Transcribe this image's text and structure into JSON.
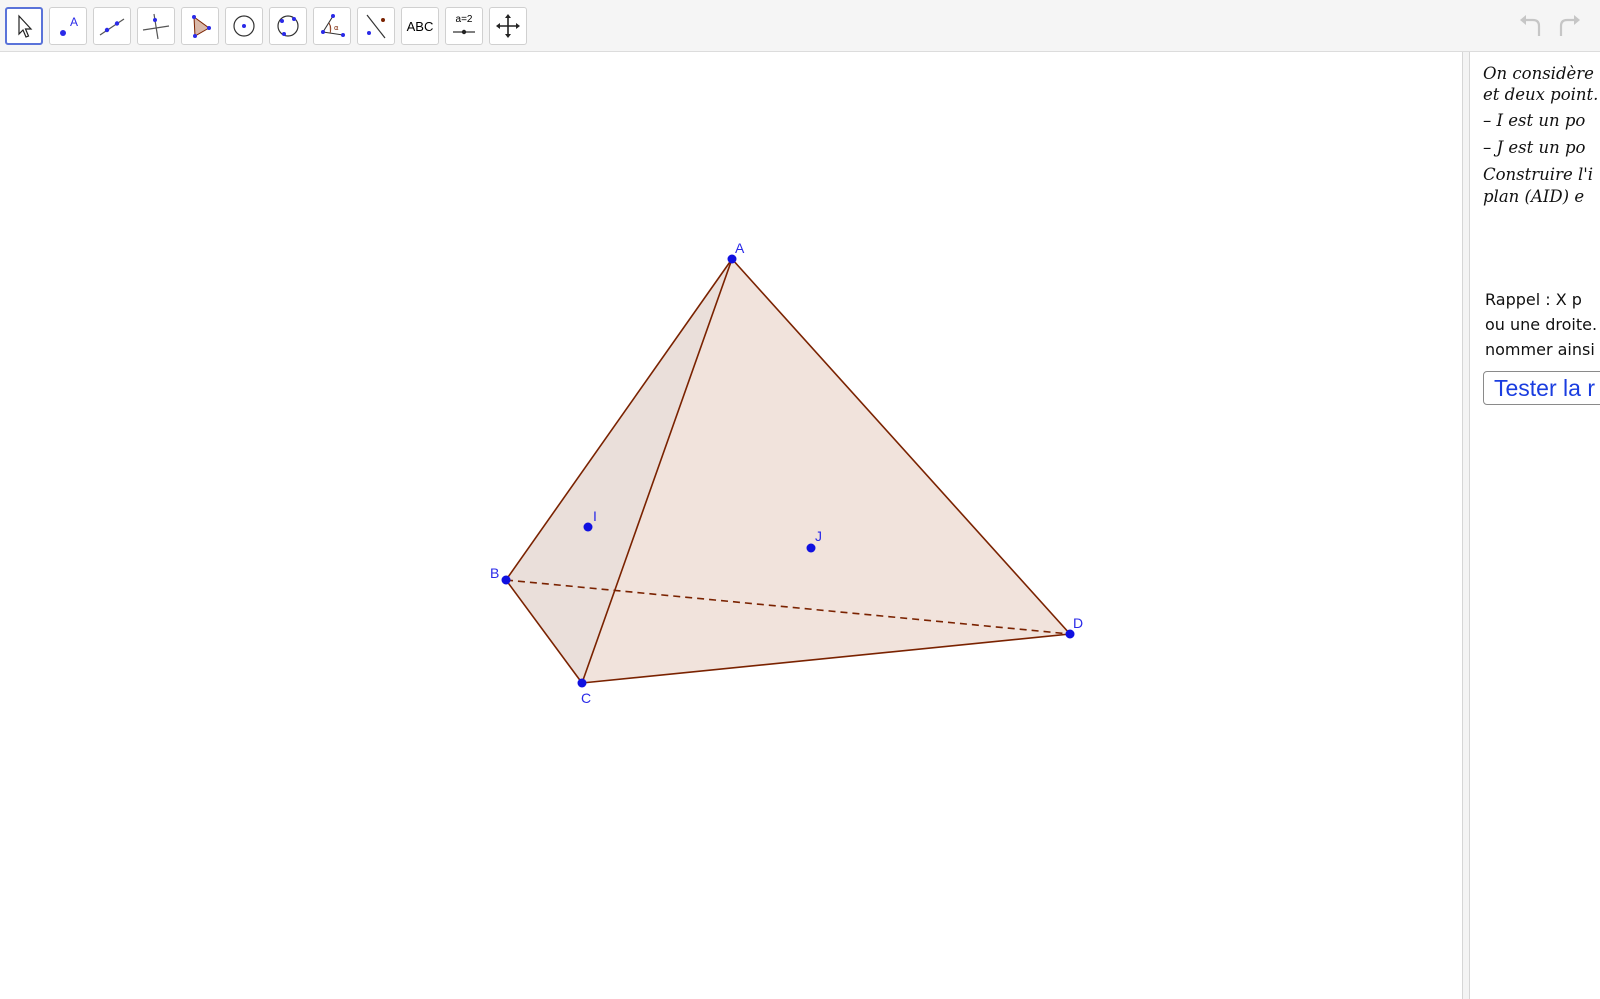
{
  "toolbar": {
    "tools": [
      {
        "name": "Move",
        "icon": "arrow-cursor-icon"
      },
      {
        "name": "Point",
        "icon": "point-icon",
        "glyph": "A"
      },
      {
        "name": "Line",
        "icon": "line-icon"
      },
      {
        "name": "Perpendicular Line",
        "icon": "perpendicular-line-icon"
      },
      {
        "name": "Polygon",
        "icon": "polygon-icon"
      },
      {
        "name": "Circle with Center",
        "icon": "circle-center-icon"
      },
      {
        "name": "Circle through 3 Points",
        "icon": "circle-3points-icon"
      },
      {
        "name": "Angle",
        "icon": "angle-icon",
        "glyph": "α"
      },
      {
        "name": "Reflect about Line",
        "icon": "reflect-line-icon"
      },
      {
        "name": "Text",
        "icon": "text-icon",
        "label": "ABC"
      },
      {
        "name": "Slider",
        "icon": "slider-icon",
        "label": "a=2"
      },
      {
        "name": "Move Graphics View",
        "icon": "move-graphics-icon"
      }
    ],
    "selected_tool": "Move"
  },
  "graphics": {
    "points": [
      {
        "label": "A"
      },
      {
        "label": "B"
      },
      {
        "label": "C"
      },
      {
        "label": "D"
      },
      {
        "label": "I"
      },
      {
        "label": "J"
      }
    ],
    "colors": {
      "point": "#1010e0",
      "edge": "#7a2200",
      "face_front": "#f0e0d8",
      "face_side": "#e8dcd6",
      "label": "#2a2ae8"
    }
  },
  "sidepanel": {
    "latex_lines": [
      "On considère",
      "et deux point.",
      "– I est un po",
      "– J est un po",
      "Construire l'i",
      "plan (AID) e"
    ],
    "reminder_lines": [
      "Rappel  :  X p",
      "ou une droite.",
      "nommer ainsi"
    ],
    "test_button": "Tester la r"
  }
}
